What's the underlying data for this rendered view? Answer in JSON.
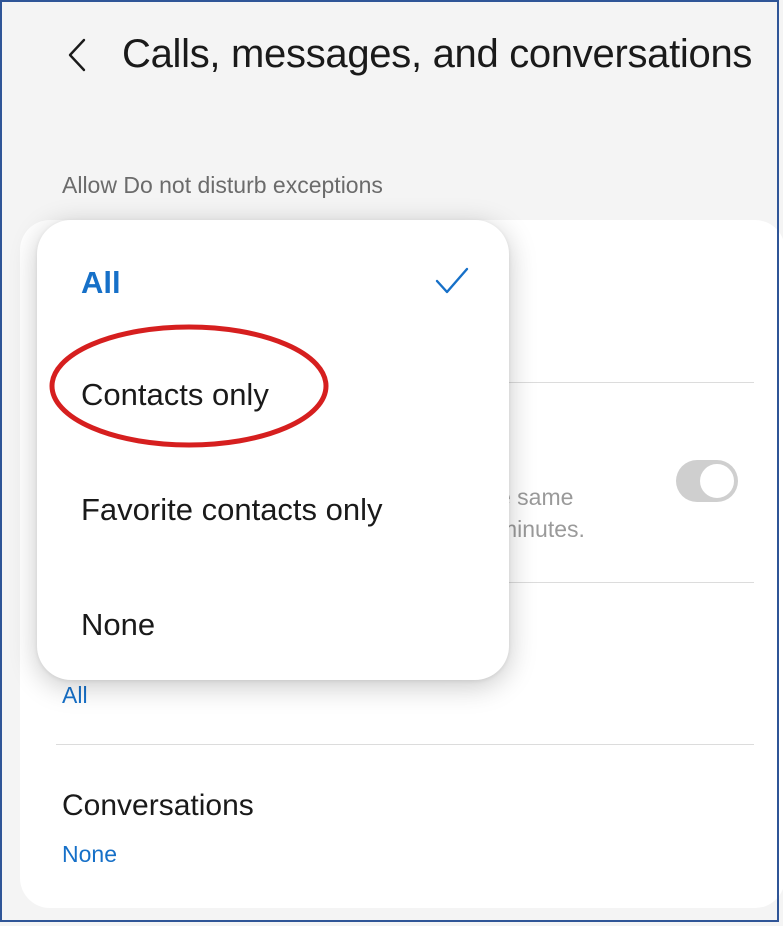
{
  "header": {
    "title": "Calls, messages, and conversations",
    "back_icon": "chevron-left-icon"
  },
  "section_label": "Allow Do not disturb exceptions",
  "background_settings": {
    "repeat_fragment_line1": "e same",
    "repeat_fragment_line2": "minutes.",
    "repeat_toggle_on": false,
    "messages_value": "All",
    "conversations": {
      "title": "Conversations",
      "value": "None"
    }
  },
  "dropdown": {
    "options": [
      "All",
      "Contacts only",
      "Favorite contacts only",
      "None"
    ],
    "selected": "All",
    "selected_icon": "checkmark-icon"
  },
  "annotation": {
    "highlighted_option": "Contacts only",
    "ring_color": "#d61f1f"
  },
  "colors": {
    "accent": "#1670c8",
    "frame_border": "#2f5597"
  }
}
